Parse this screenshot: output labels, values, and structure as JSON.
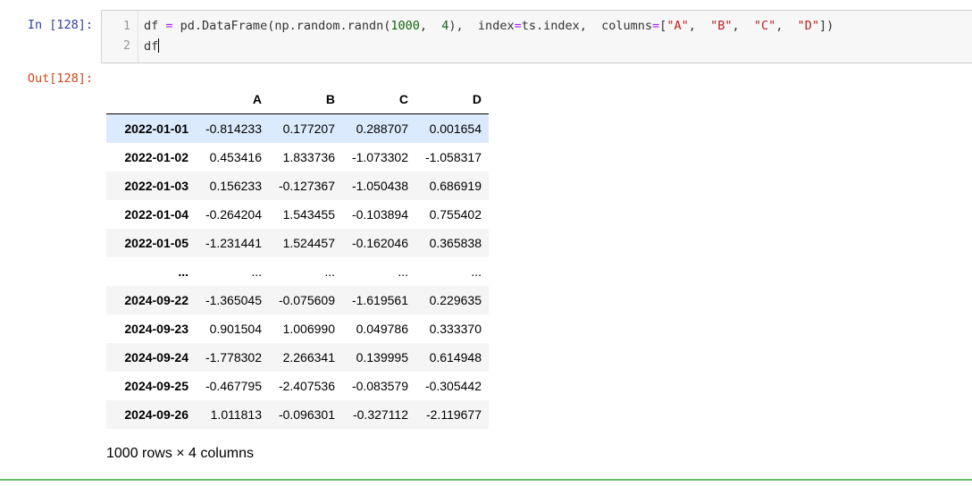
{
  "input": {
    "prompt": "In  [128]:",
    "line_numbers": [
      "1",
      "2"
    ],
    "line1_parts": [
      "df ",
      "=",
      " pd.DataFrame(np.random.randn(",
      "1000",
      ",  ",
      "4",
      "),  index",
      "=",
      "ts.index,  columns",
      "=",
      "[",
      "\"A\"",
      ",  ",
      "\"B\"",
      ",  ",
      "\"C\"",
      ",  ",
      "\"D\"",
      "])"
    ],
    "line2": "df"
  },
  "output": {
    "prompt": "Out[128]:",
    "columns": [
      "",
      "A",
      "B",
      "C",
      "D"
    ],
    "rows": [
      {
        "index": "2022-01-01",
        "values": [
          "-0.814233",
          "0.177207",
          "0.288707",
          "0.001654"
        ]
      },
      {
        "index": "2022-01-02",
        "values": [
          "0.453416",
          "1.833736",
          "-1.073302",
          "-1.058317"
        ]
      },
      {
        "index": "2022-01-03",
        "values": [
          "0.156233",
          "-0.127367",
          "-1.050438",
          "0.686919"
        ]
      },
      {
        "index": "2022-01-04",
        "values": [
          "-0.264204",
          "1.543455",
          "-0.103894",
          "0.755402"
        ]
      },
      {
        "index": "2022-01-05",
        "values": [
          "-1.231441",
          "1.524457",
          "-0.162046",
          "0.365838"
        ]
      },
      {
        "index": "...",
        "values": [
          "...",
          "...",
          "...",
          "..."
        ]
      },
      {
        "index": "2024-09-22",
        "values": [
          "-1.365045",
          "-0.075609",
          "-1.619561",
          "0.229635"
        ]
      },
      {
        "index": "2024-09-23",
        "values": [
          "0.901504",
          "1.006990",
          "0.049786",
          "0.333370"
        ]
      },
      {
        "index": "2024-09-24",
        "values": [
          "-1.778302",
          "2.266341",
          "0.139995",
          "0.614948"
        ]
      },
      {
        "index": "2024-09-25",
        "values": [
          "-0.467795",
          "-2.407536",
          "-0.083579",
          "-0.305442"
        ]
      },
      {
        "index": "2024-09-26",
        "values": [
          "1.011813",
          "-0.096301",
          "-0.327112",
          "-2.119677"
        ]
      }
    ],
    "summary": "1000 rows × 4 columns"
  },
  "colors": {
    "in_prompt": "#303f9f",
    "out_prompt": "#d84315",
    "cell_border": "#66bb6a",
    "row_hover": "#dbeafc",
    "row_odd": "#f5f5f5"
  }
}
